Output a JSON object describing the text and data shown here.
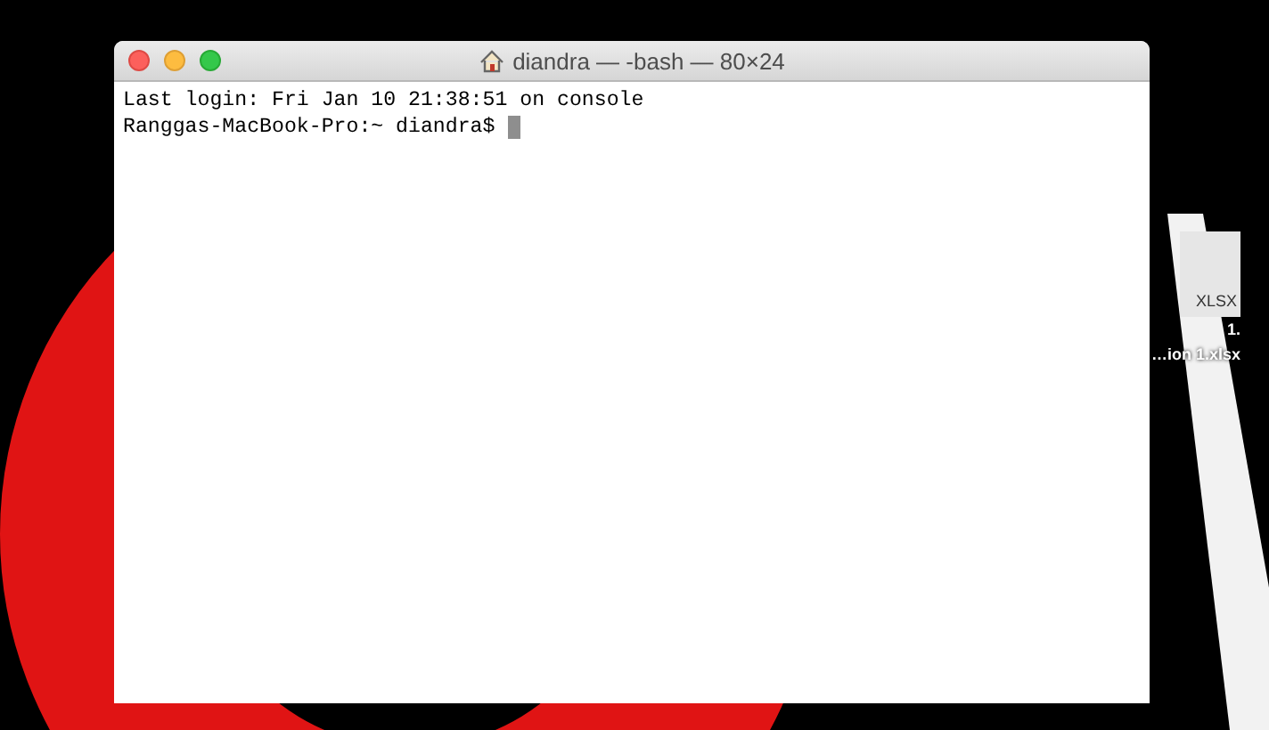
{
  "window": {
    "title": "diandra — -bash — 80×24",
    "output_lines": [
      "Last login: Fri Jan 10 21:38:51 on console"
    ],
    "prompt": "Ranggas-MacBook-Pro:~ diandra$"
  },
  "desktop_icon": {
    "badge": "XLSX",
    "label_lines": [
      "1.",
      "…ion 1.xlsx"
    ]
  }
}
